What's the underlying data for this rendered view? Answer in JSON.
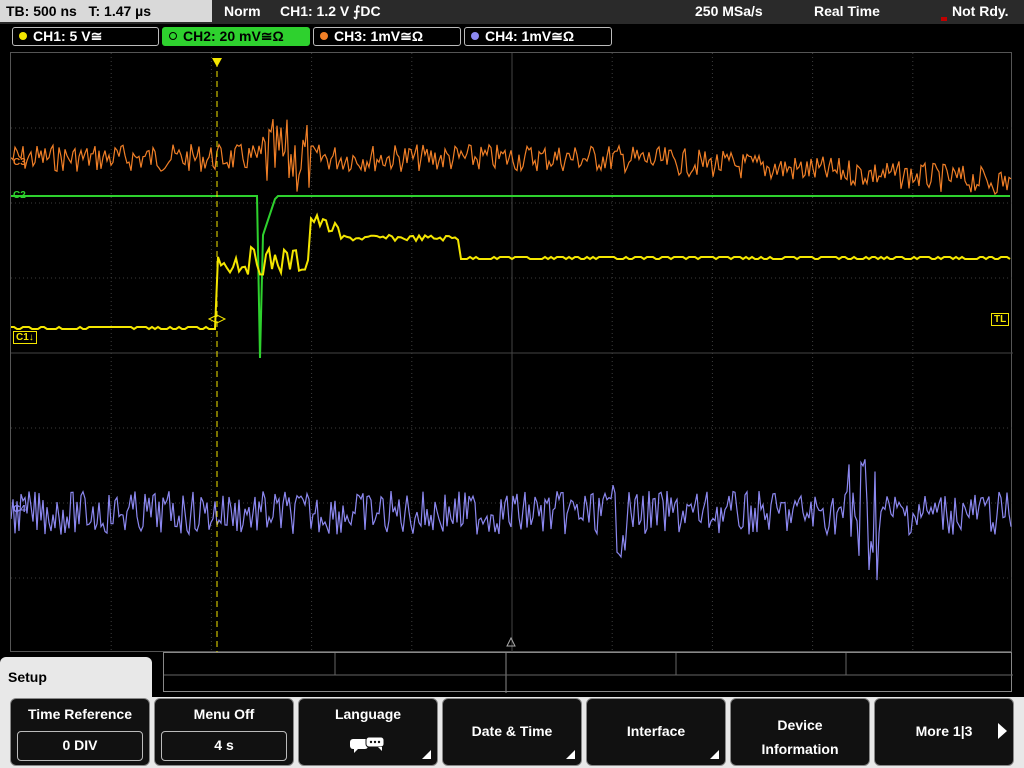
{
  "topbar": {
    "timebase": "TB: 500 ns",
    "trigger_time": "T: 1.47 µs",
    "mode": "Norm",
    "trigger_info": "CH1: 1.2 V ⨍DC",
    "sample_rate": "250 MSa/s",
    "acq_mode": "Real Time",
    "status": "Not Rdy."
  },
  "channels": [
    {
      "label": "CH1: 5 V≅",
      "color": "#f4e600"
    },
    {
      "label": "CH2: 20 mV≅Ω",
      "color": "#2ed12e"
    },
    {
      "label": "CH3: 1mV≅Ω",
      "color": "#f07f27"
    },
    {
      "label": "CH4: 1mV≅Ω",
      "color": "#8c88f0"
    }
  ],
  "markers": {
    "ch1": "C1",
    "ch2": "C2",
    "ch3": "C3",
    "ch4": "C4",
    "trigger_level": "TL"
  },
  "menu": {
    "tab": "Setup",
    "softkeys": [
      {
        "label": "Time Reference",
        "value": "0 DIV"
      },
      {
        "label": "Menu Off",
        "value": "4 s"
      },
      {
        "label": "Language",
        "icon": "speech-bubbles-icon"
      },
      {
        "label": "Date & Time"
      },
      {
        "label": "Interface"
      },
      {
        "label_line1": "Device",
        "label_line2": "Information"
      },
      {
        "label": "More 1|3"
      }
    ]
  }
}
